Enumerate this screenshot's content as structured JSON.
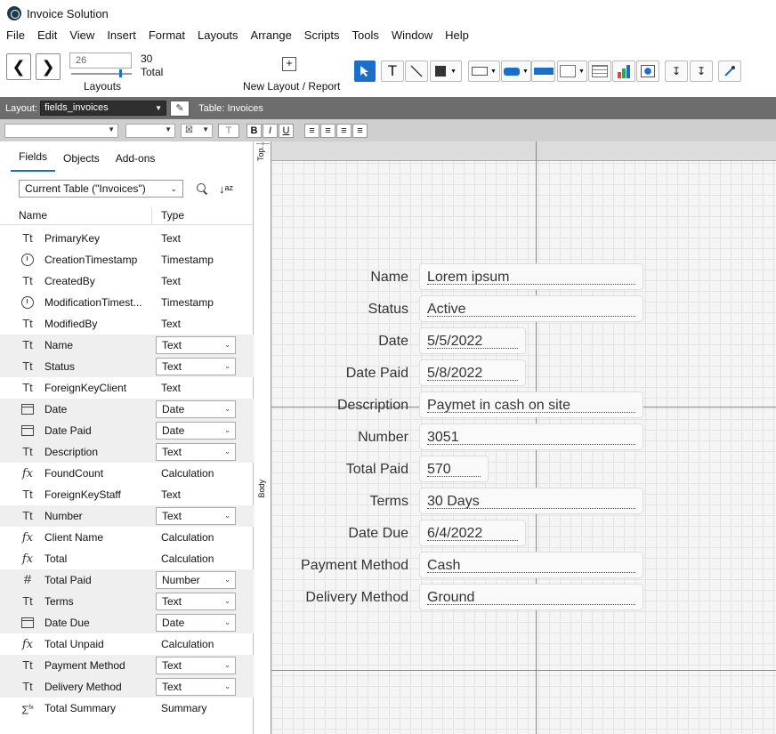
{
  "window": {
    "title": "Invoice Solution"
  },
  "menu": [
    "File",
    "Edit",
    "View",
    "Insert",
    "Format",
    "Layouts",
    "Arrange",
    "Scripts",
    "Tools",
    "Window",
    "Help"
  ],
  "toolbar": {
    "record_input": "26",
    "record_count": "30",
    "total_label": "Total",
    "layouts_label": "Layouts",
    "new_layout_label": "New Layout / Report"
  },
  "layoutbar": {
    "layout_label": "Layout:",
    "layout_value": "fields_invoices",
    "table_label": "Table: Invoices"
  },
  "panel": {
    "tabs": [
      "Fields",
      "Objects",
      "Add-ons"
    ],
    "table_select": "Current Table (\"Invoices\")",
    "col_name": "Name",
    "col_type": "Type",
    "fields": [
      {
        "name": "PrimaryKey",
        "type": "Text",
        "icon": "Tt",
        "sel": false
      },
      {
        "name": "CreationTimestamp",
        "type": "Timestamp",
        "icon": "clock",
        "sel": false
      },
      {
        "name": "CreatedBy",
        "type": "Text",
        "icon": "Tt",
        "sel": false
      },
      {
        "name": "ModificationTimest...",
        "type": "Timestamp",
        "icon": "clock",
        "sel": false
      },
      {
        "name": "ModifiedBy",
        "type": "Text",
        "icon": "Tt",
        "sel": false
      },
      {
        "name": "Name",
        "type": "Text",
        "icon": "Tt",
        "sel": true
      },
      {
        "name": "Status",
        "type": "Text",
        "icon": "Tt",
        "sel": true
      },
      {
        "name": "ForeignKeyClient",
        "type": "Text",
        "icon": "Tt",
        "sel": false
      },
      {
        "name": "Date",
        "type": "Date",
        "icon": "cal",
        "sel": true
      },
      {
        "name": "Date Paid",
        "type": "Date",
        "icon": "cal",
        "sel": true
      },
      {
        "name": "Description",
        "type": "Text",
        "icon": "Tt",
        "sel": true
      },
      {
        "name": "FoundCount",
        "type": "Calculation",
        "icon": "fx",
        "sel": false
      },
      {
        "name": "ForeignKeyStaff",
        "type": "Text",
        "icon": "Tt",
        "sel": false
      },
      {
        "name": "Number",
        "type": "Text",
        "icon": "Tt",
        "sel": true
      },
      {
        "name": "Client Name",
        "type": "Calculation",
        "icon": "fx",
        "sel": false
      },
      {
        "name": "Total",
        "type": "Calculation",
        "icon": "fx",
        "sel": false
      },
      {
        "name": "Total Paid",
        "type": "Number",
        "icon": "#",
        "sel": true
      },
      {
        "name": "Terms",
        "type": "Text",
        "icon": "Tt",
        "sel": true
      },
      {
        "name": "Date Due",
        "type": "Date",
        "icon": "cal",
        "sel": true
      },
      {
        "name": "Total Unpaid",
        "type": "Calculation",
        "icon": "fx",
        "sel": false
      },
      {
        "name": "Payment Method",
        "type": "Text",
        "icon": "Tt",
        "sel": true
      },
      {
        "name": "Delivery Method",
        "type": "Text",
        "icon": "Tt",
        "sel": true
      },
      {
        "name": "Total Summary",
        "type": "Summary",
        "icon": "sum",
        "sel": false
      }
    ]
  },
  "canvas": {
    "part_top": "Top...",
    "part_body": "Body",
    "form": [
      {
        "label": "Name",
        "value": "Lorem ipsum"
      },
      {
        "label": "Status",
        "value": "Active"
      },
      {
        "label": "Date",
        "value": "5/5/2022"
      },
      {
        "label": "Date Paid",
        "value": "5/8/2022"
      },
      {
        "label": "Description",
        "value": "Paymet in cash on site"
      },
      {
        "label": "Number",
        "value": "3051"
      },
      {
        "label": "Total Paid",
        "value": "570"
      },
      {
        "label": "Terms",
        "value": "30 Days"
      },
      {
        "label": "Date Due",
        "value": "6/4/2022"
      },
      {
        "label": "Payment Method",
        "value": "Cash"
      },
      {
        "label": "Delivery Method",
        "value": "Ground"
      }
    ]
  }
}
